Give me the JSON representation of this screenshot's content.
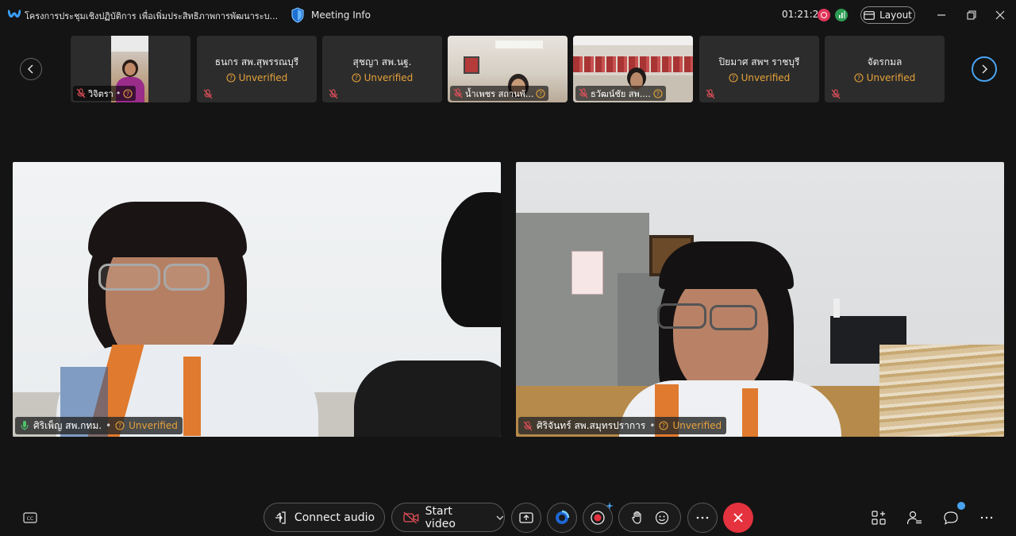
{
  "window": {
    "title": "โครงการประชุมเชิงปฏิบัติการ เพื่อเพิ่มประสิทธิภาพการพัฒนาระบ...",
    "meeting_info_label": "Meeting Info",
    "timer": "01:21:29",
    "layout_label": "Layout"
  },
  "thumbnails": [
    {
      "name": "วิจิตรา",
      "has_video": true
    },
    {
      "name": "ธนกร สพ.สุพรรณบุรี",
      "status": "Unverified",
      "has_video": false
    },
    {
      "name": "สุชญา สพ.นฐ.",
      "status": "Unverified",
      "has_video": false
    },
    {
      "name": "น้ำเพชร สถานพั...",
      "has_video": true
    },
    {
      "name": "ธวัฒน์ชัย สพ....",
      "has_video": true
    },
    {
      "name": "ปิยมาศ สพฯ ราชบุรี",
      "status": "Unverified",
      "has_video": false
    },
    {
      "name": "จัตรกมล",
      "status": "Unverified",
      "has_video": false
    }
  ],
  "tiles": [
    {
      "name": "ศิริเพ็ญ สพ.กทม.",
      "status": "Unverified",
      "mic": "active"
    },
    {
      "name": "ศิริจันทร์ สพ.สมุทรปราการ",
      "status": "Unverified",
      "mic": "muted"
    }
  ],
  "toolbar": {
    "connect_audio": "Connect audio",
    "start_video": "Start video"
  },
  "colors": {
    "background": "#141414",
    "unverified": "#e5a23a",
    "end_call": "#e5323f",
    "accent": "#4aa3f0"
  }
}
